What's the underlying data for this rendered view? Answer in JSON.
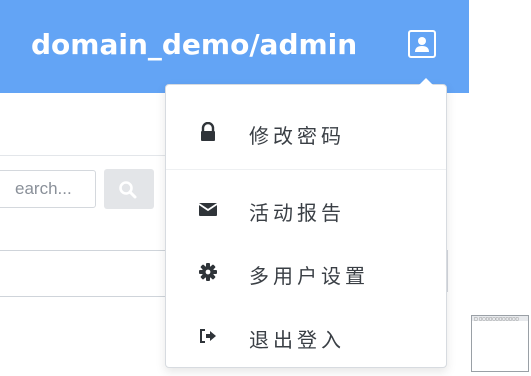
{
  "header": {
    "title": "domain_demo/admin"
  },
  "search": {
    "placeholder": "earch..."
  },
  "user_menu": {
    "items": [
      {
        "icon": "lock-icon",
        "label": "修改密码"
      },
      {
        "icon": "envelope-icon",
        "label": "活动报告"
      },
      {
        "icon": "gear-icon",
        "label": "多用户设置"
      },
      {
        "icon": "sign-out-icon",
        "label": "退出登入"
      }
    ]
  },
  "thumbnail": {
    "caption": "□ ◻◻◻◻◻◻◻◻◻◻◻◻"
  },
  "colors": {
    "topbar": "#63a4f5",
    "text": "#3a3f45",
    "icon": "#2f3439"
  }
}
